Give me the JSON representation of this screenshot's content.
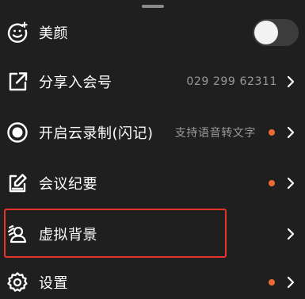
{
  "menu": {
    "beauty": {
      "label": "美颜",
      "icon": "smiley-sparkle-icon",
      "toggle_on": false
    },
    "share": {
      "label": "分享入会号",
      "icon": "share-external-icon",
      "value": "029 299 62311"
    },
    "record": {
      "label": "开启云录制(闪记)",
      "icon": "record-icon",
      "value": "支持语音转文字",
      "has_dot": true
    },
    "minutes": {
      "label": "会议纪要",
      "icon": "note-edit-icon",
      "has_dot": true
    },
    "background": {
      "label": "虚拟背景",
      "icon": "virtual-background-icon"
    },
    "settings": {
      "label": "设置",
      "icon": "gear-icon",
      "has_dot": true
    }
  },
  "colors": {
    "background": "#1f1f1f",
    "dot": "#ee6a35",
    "highlight": "#e5352b",
    "secondary_text": "#9a9a9a"
  }
}
